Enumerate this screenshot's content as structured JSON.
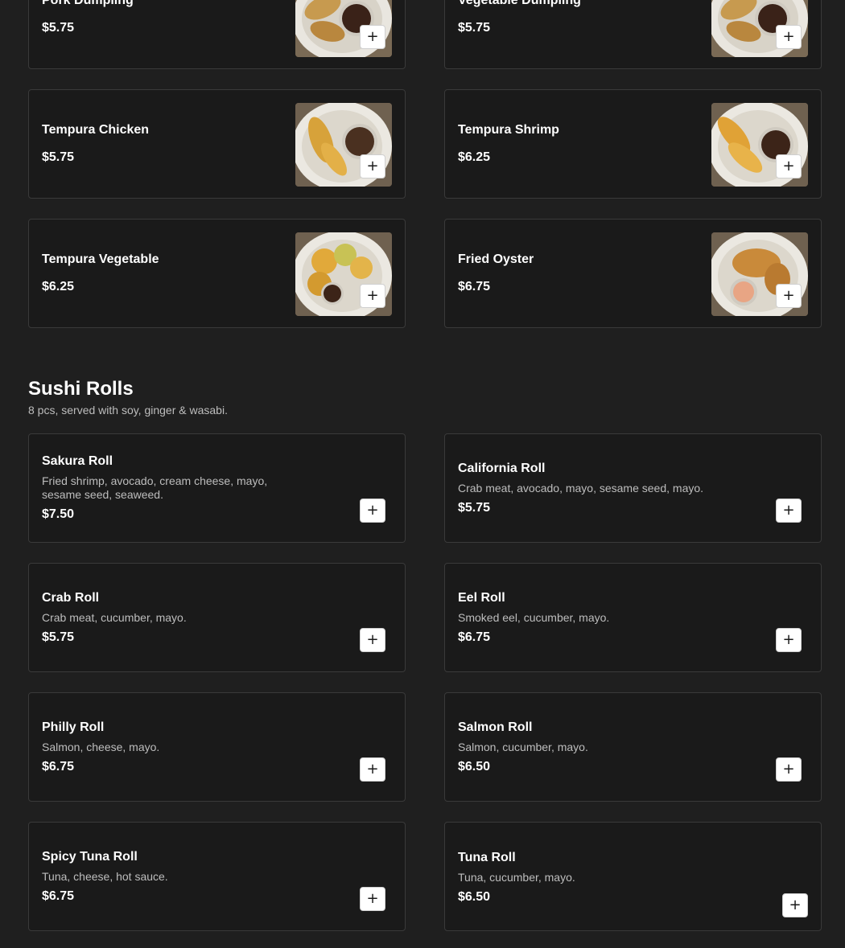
{
  "appetizers": {
    "items": [
      {
        "name": "Pork Dumpling",
        "price": "$5.75",
        "image": "dumpling-plate"
      },
      {
        "name": "Vegetable Dumpling",
        "price": "$5.75",
        "image": "dumpling-plate"
      },
      {
        "name": "Tempura Chicken",
        "price": "$5.75",
        "image": "tempura-plate"
      },
      {
        "name": "Tempura Shrimp",
        "price": "$6.25",
        "image": "tempura-plate"
      },
      {
        "name": "Tempura Vegetable",
        "price": "$6.25",
        "image": "tempura-plate"
      },
      {
        "name": "Fried Oyster",
        "price": "$6.75",
        "image": "fried-plate"
      }
    ]
  },
  "sushi_rolls": {
    "title": "Sushi Rolls",
    "subtitle": "8 pcs, served with soy, ginger & wasabi.",
    "items": [
      {
        "name": "Sakura Roll",
        "desc": "Fried shrimp, avocado, cream cheese, mayo, sesame seed, seaweed.",
        "price": "$7.50"
      },
      {
        "name": "California Roll",
        "desc": "Crab meat, avocado, mayo, sesame seed, mayo.",
        "price": "$5.75"
      },
      {
        "name": "Crab Roll",
        "desc": "Crab meat, cucumber, mayo.",
        "price": "$5.75"
      },
      {
        "name": "Eel Roll",
        "desc": "Smoked eel, cucumber, mayo.",
        "price": "$6.75"
      },
      {
        "name": "Philly Roll",
        "desc": "Salmon, cheese, mayo.",
        "price": "$6.75"
      },
      {
        "name": "Salmon Roll",
        "desc": "Salmon, cucumber, mayo.",
        "price": "$6.50"
      },
      {
        "name": "Spicy Tuna Roll",
        "desc": "Tuna, cheese, hot sauce.",
        "price": "$6.75"
      },
      {
        "name": "Tuna Roll",
        "desc": "Tuna, cucumber, mayo.",
        "price": "$6.50"
      }
    ]
  },
  "add_button_icon": "plus-icon",
  "colors": {
    "background": "#1f1f1f",
    "card": "#1a1a1a",
    "card_border": "#3a3a3a",
    "text": "#ffffff",
    "muted_text": "#bdbdbd",
    "button": "#ffffff"
  }
}
